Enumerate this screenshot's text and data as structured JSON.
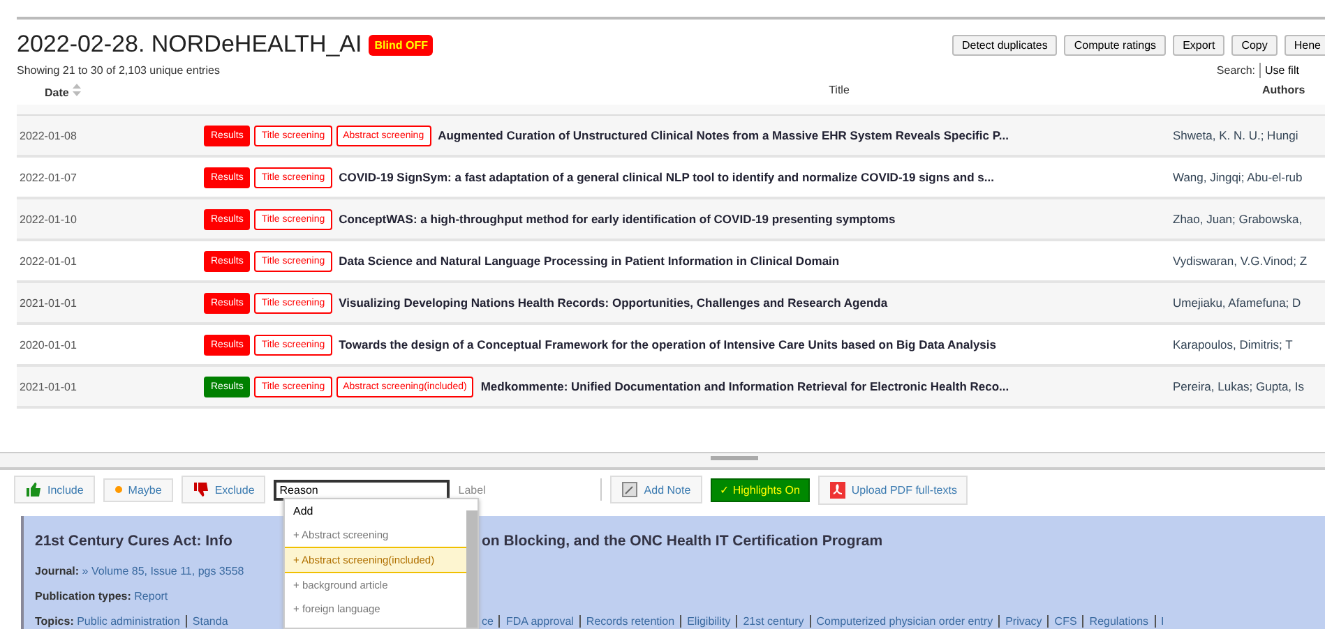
{
  "header": {
    "title": "2022-02-28. NORDeHEALTH_AI",
    "badge": "Blind OFF",
    "info": "Showing 21 to 30 of 2,103 unique entries"
  },
  "actions": [
    "Detect duplicates",
    "Compute ratings",
    "Export",
    "Copy",
    "Hene"
  ],
  "search": {
    "label": "Search:",
    "value": "Use filt"
  },
  "table": {
    "columns": [
      "Date",
      "Title",
      "Authors"
    ],
    "rows": [
      {
        "date": "2022-01-08",
        "tags": [
          {
            "label": "Results",
            "kind": "solid",
            "color": "#ff0000"
          },
          {
            "label": "Title screening",
            "kind": "outline",
            "color": "#ff0000"
          },
          {
            "label": "Abstract screening",
            "kind": "outline",
            "color": "#ff0000"
          }
        ],
        "title": "Augmented Curation of Unstructured Clinical Notes from a Massive EHR System Reveals Specific P...",
        "authors": "Shweta, K. N. U.; Hungi"
      },
      {
        "date": "2022-01-07",
        "tags": [
          {
            "label": "Results",
            "kind": "solid",
            "color": "#ff0000"
          },
          {
            "label": "Title screening",
            "kind": "outline",
            "color": "#ff0000"
          }
        ],
        "title": "COVID-19 SignSym: a fast adaptation of a general clinical NLP tool to identify and normalize COVID-19 signs and s...",
        "authors": "Wang, Jingqi; Abu-el-rub"
      },
      {
        "date": "2022-01-10",
        "tags": [
          {
            "label": "Results",
            "kind": "solid",
            "color": "#ff0000"
          },
          {
            "label": "Title screening",
            "kind": "outline",
            "color": "#ff0000"
          }
        ],
        "title": "ConceptWAS: a high-throughput method for early identification of COVID-19 presenting symptoms",
        "authors": "Zhao, Juan; Grabowska,"
      },
      {
        "date": "2022-01-01",
        "tags": [
          {
            "label": "Results",
            "kind": "solid",
            "color": "#ff0000"
          },
          {
            "label": "Title screening",
            "kind": "outline",
            "color": "#ff0000"
          }
        ],
        "title": "Data Science and Natural Language Processing in Patient Information in Clinical Domain",
        "authors": "Vydiswaran, V.G.Vinod; Z"
      },
      {
        "date": "2021-01-01",
        "tags": [
          {
            "label": "Results",
            "kind": "solid",
            "color": "#ff0000"
          },
          {
            "label": "Title screening",
            "kind": "outline",
            "color": "#ff0000"
          }
        ],
        "title": "Visualizing Developing Nations Health Records: Opportunities, Challenges and Research Agenda",
        "authors": "Umejiaku, Afamefuna; D"
      },
      {
        "date": "2020-01-01",
        "tags": [
          {
            "label": "Results",
            "kind": "solid",
            "color": "#ff0000"
          },
          {
            "label": "Title screening",
            "kind": "outline",
            "color": "#ff0000"
          }
        ],
        "title": "Towards the design of a Conceptual Framework for the operation of Intensive Care Units based on Big Data Analysis",
        "authors": "Karapoulos, Dimitris; T"
      },
      {
        "date": "2021-01-01",
        "tags": [
          {
            "label": "Results",
            "kind": "solid",
            "color": "#008000"
          },
          {
            "label": "Title screening",
            "kind": "outline",
            "color": "#ff0000"
          },
          {
            "label": "Abstract screening(included)",
            "kind": "outline",
            "color": "#ff0000"
          }
        ],
        "title": "Medkommente: Unified Documentation and Information Retrieval for Electronic Health Reco...",
        "authors": "Pereira, Lukas; Gupta, Is"
      }
    ]
  },
  "decision": {
    "buttons": [
      {
        "label": "Include",
        "kind": "include"
      },
      {
        "label": "Maybe",
        "kind": "maybe"
      },
      {
        "label": "Exclude",
        "kind": "exclude"
      }
    ],
    "reason": "Reason",
    "label": "Label",
    "add_note": "Add Note",
    "highlights": "✓ Highlights On",
    "upload": "Upload PDF full-texts"
  },
  "dropdown": {
    "heading": "Add",
    "items": [
      {
        "label": "+ Abstract screening",
        "selected": false
      },
      {
        "label": "+ Abstract screening(included)",
        "selected": true
      },
      {
        "label": "+ background article",
        "selected": false
      },
      {
        "label": "+ foreign language",
        "selected": false
      }
    ]
  },
  "article": {
    "title_left": "21st Century Cures Act: Info",
    "title_right": "on Blocking, and the ONC Health IT Certification Program",
    "journal_label": "Journal:",
    "journal": "» Volume 85, Issue 11, pgs 3558",
    "pubtype_label": "Publication types:",
    "pubtype": "Report",
    "topics_label": "Topics:",
    "topics_left": [
      "Public administration",
      "Standa"
    ],
    "topics_right": [
      "ce",
      "FDA approval",
      "Records retention",
      "Eligibility",
      "21st century",
      "Computerized physician order entry",
      "Privacy",
      "CFS",
      "Regulations",
      "I"
    ]
  }
}
